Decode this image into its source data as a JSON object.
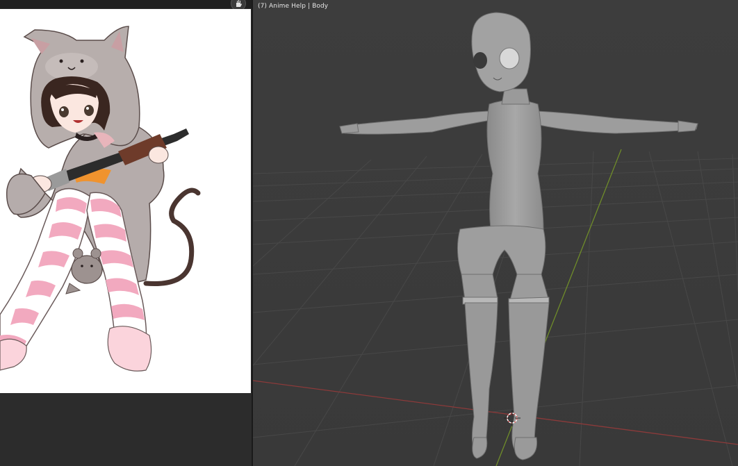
{
  "viewport": {
    "label": "(7) Anime Help | Body"
  },
  "reference": {
    "hand_icon": "hand-pan-icon",
    "subject": "cat-hood-girl-reference"
  },
  "colors": {
    "viewport_bg": "#3c3c3c",
    "grid_line": "#4a4a4a",
    "x_axis": "#8c3a3a",
    "y_axis": "#6f8c2a",
    "mesh": "#9a9a9a",
    "panel_bg": "#2c2c2c"
  }
}
